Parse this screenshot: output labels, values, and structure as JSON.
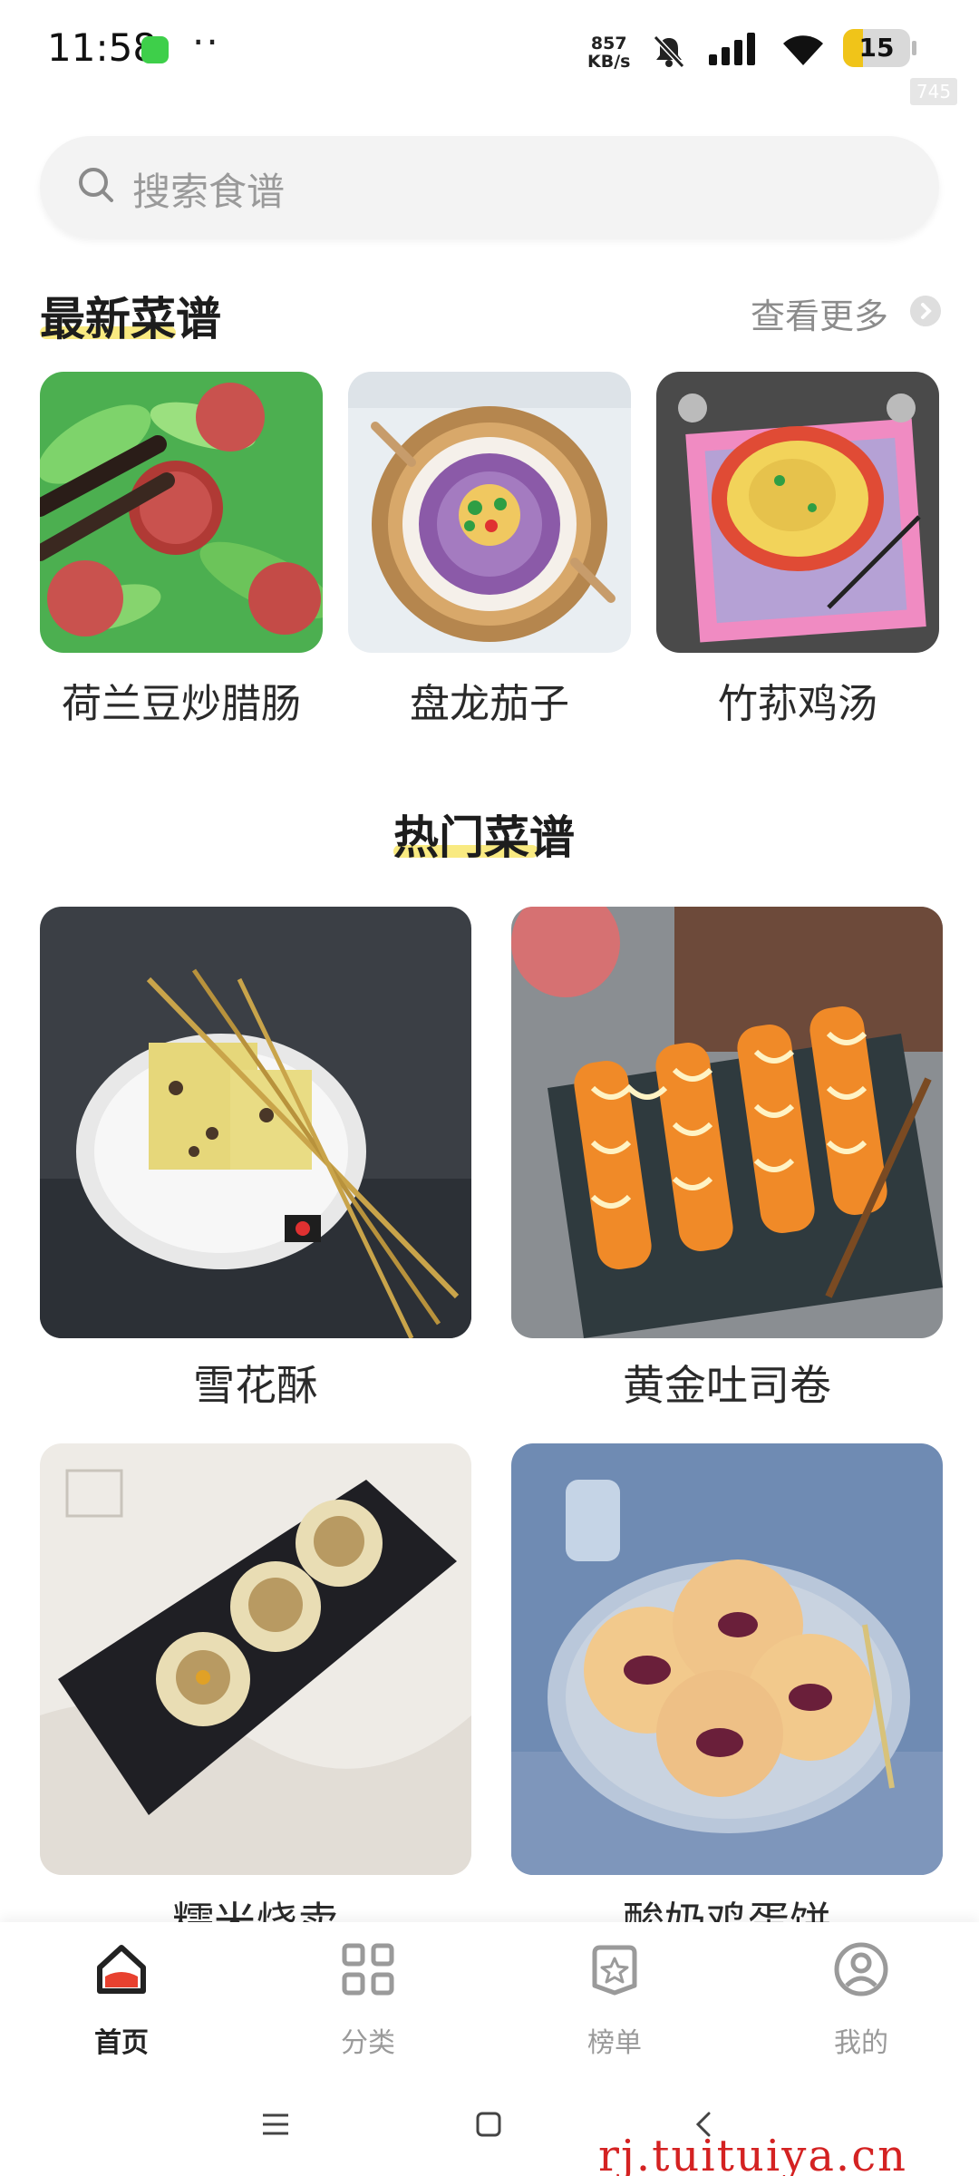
{
  "status_bar": {
    "time": "11:58",
    "dots": "··",
    "net_speed_value": "857",
    "net_speed_unit": "KB/s",
    "battery": "15",
    "corner_badge": "745"
  },
  "search": {
    "placeholder": "搜索食谱"
  },
  "latest": {
    "title": "最新菜谱",
    "see_more": "查看更多",
    "items": [
      {
        "name": "荷兰豆炒腊肠"
      },
      {
        "name": "盘龙茄子"
      },
      {
        "name": "竹荪鸡汤"
      }
    ]
  },
  "hot": {
    "title": "热门菜谱",
    "items": [
      {
        "name": "雪花酥"
      },
      {
        "name": "黄金吐司卷"
      },
      {
        "name": "糯米烧卖"
      },
      {
        "name": "酸奶鸡蛋饼"
      }
    ]
  },
  "tab_bar": {
    "tabs": [
      {
        "label": "首页",
        "icon": "home-icon",
        "active": true
      },
      {
        "label": "分类",
        "icon": "grid-icon",
        "active": false
      },
      {
        "label": "榜单",
        "icon": "star-list-icon",
        "active": false
      },
      {
        "label": "我的",
        "icon": "profile-icon",
        "active": false
      }
    ]
  },
  "watermark": "rj.tuituiya.cn",
  "colors": {
    "accent_underline": "#f8e66b",
    "home_accent": "#e8412f",
    "text_primary": "#222222",
    "text_muted": "#9a9a9a"
  }
}
